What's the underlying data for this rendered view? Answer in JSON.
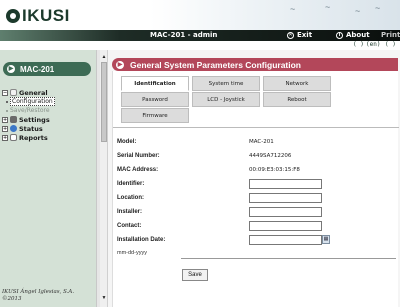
{
  "brand": {
    "logo_text": "IKUSI"
  },
  "titlebar": {
    "title": "MAC-201 - admin",
    "exit_label": "Exit",
    "about_label": "About",
    "print_label": "Print"
  },
  "langbar": {
    "lang1": "( )",
    "lang2": "(en)",
    "lang3": "( )"
  },
  "sidebar": {
    "header": "MAC-201",
    "tree": {
      "general": "General",
      "configuration": "Configuration",
      "save_restore": "Save/Restore",
      "settings": "Settings",
      "status": "Status",
      "reports": "Reports"
    },
    "footer_line1": "IKUSI Ángel Iglesias, S.A.",
    "footer_line2": "©2013"
  },
  "panel": {
    "title": "General System Parameters Configuration",
    "tabs": [
      {
        "label": "Identification"
      },
      {
        "label": "System time"
      },
      {
        "label": "Network"
      },
      {
        "label": "Password"
      },
      {
        "label": "LCD - Joystick"
      },
      {
        "label": "Reboot"
      },
      {
        "label": "Firmware"
      }
    ],
    "form": {
      "model_label": "Model:",
      "model_value": "MAC-201",
      "serial_label": "Serial Number:",
      "serial_value": "4449SA712206",
      "mac_label": "MAC Address:",
      "mac_value": "00:09:E3:03:15:F8",
      "identifier_label": "Identifier:",
      "identifier_value": "",
      "location_label": "Location:",
      "location_value": "",
      "installer_label": "Installer:",
      "installer_value": "",
      "contact_label": "Contact:",
      "contact_value": "",
      "install_date_label": "Installation Date:",
      "install_date_value": "",
      "date_hint": "mm-dd-yyyy",
      "save_label": "Save"
    }
  },
  "colors": {
    "sidebar_bg": "#d4e1d6",
    "sidebar_header": "#3d6b55",
    "panel_header": "#b3475a",
    "titlebar_dark": "#0b0f0d"
  }
}
